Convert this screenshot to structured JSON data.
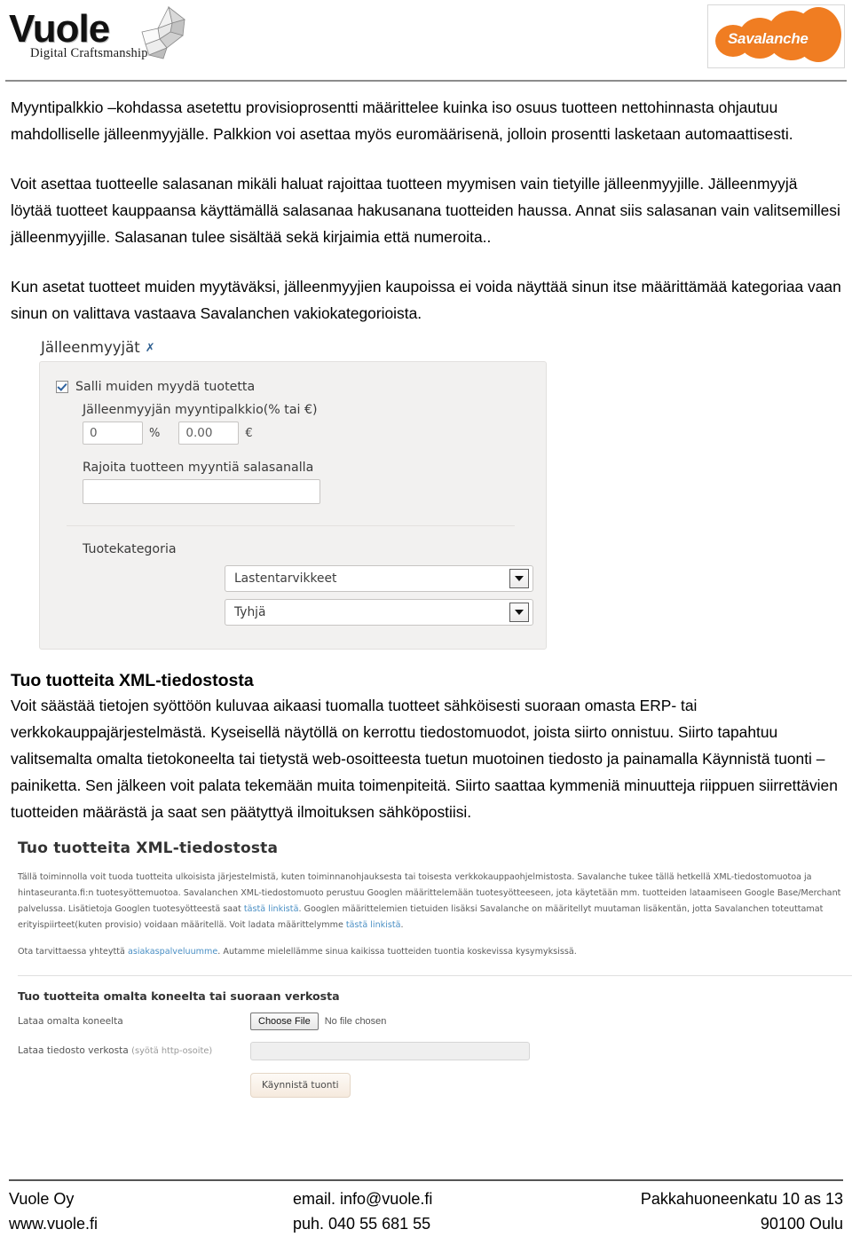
{
  "header": {
    "left_logo": {
      "word": "Vuole",
      "tagline": "Digital Craftsmanship",
      "bird_icon": "origami-bird-icon"
    },
    "right_logo": {
      "word": "Savalanche",
      "brand_color": "#f07d22"
    }
  },
  "body": {
    "para1": "Myyntipalkkio –kohdassa asetettu provisioprosentti määrittelee kuinka iso osuus tuotteen nettohinnasta ohjautuu mahdolliselle jälleenmyyjälle. Palkkion voi asettaa myös euromäärisenä, jolloin prosentti lasketaan automaattisesti.",
    "para2": "Voit asettaa tuotteelle salasanan mikäli haluat rajoittaa tuotteen myymisen vain tietyille jälleenmyyjille. Jälleenmyyjä löytää tuotteet kauppaansa käyttämällä salasanaa hakusanana tuotteiden haussa. Annat siis salasanan vain valitsemillesi jälleenmyyjille. Salasanan tulee sisältää sekä kirjaimia että numeroita..",
    "para3": "Kun asetat tuotteet muiden myytäväksi, jälleenmyyjien kaupoissa ei voida näyttää sinun itse määrittämää kategoriaa vaan sinun on valittava vastaava Savalanchen vakiokategorioista."
  },
  "reseller_panel": {
    "section_title": "Jälleenmyyjät",
    "chevron": "❯",
    "checkbox_label": "Salli muiden myydä tuotetta",
    "checkbox_checked": true,
    "commission_label": "Jälleenmyyjän myyntipalkkio(% tai €)",
    "percent_value": "0",
    "percent_unit": "%",
    "euro_value": "0.00",
    "euro_unit": "€",
    "password_label": "Rajoita tuotteen myyntiä salasanalla",
    "password_value": "",
    "category_label": "Tuotekategoria",
    "category_select_1": "Lastentarvikkeet",
    "category_select_2": "Tyhjä"
  },
  "section_xml": {
    "heading": "Tuo tuotteita XML-tiedostosta",
    "paragraph": "Voit säästää tietojen syöttöön kuluvaa aikaasi tuomalla tuotteet sähköisesti suoraan omasta ERP- tai verkkokauppajärjestelmästä. Kyseisellä näytöllä on kerrottu tiedostomuodot, joista siirto onnistuu. Siirto tapahtuu valitsemalta omalta tietokoneelta tai tietystä web-osoitteesta tuetun muotoinen tiedosto ja painamalla Käynnistä tuonti –painiketta. Sen jälkeen voit palata tekemään muita toimenpiteitä. Siirto saattaa kymmeniä minuutteja riippuen siirrettävien tuotteiden määrästä ja saat sen päätyttyä ilmoituksen sähköpostiisi."
  },
  "import_screen": {
    "title": "Tuo tuotteita XML-tiedostosta",
    "info_part1": "Tällä toiminnolla voit tuoda tuotteita ulkoisista järjestelmistä, kuten toiminnanohjauksesta tai toisesta verkkokauppaohjelmistosta. Savalanche tukee tällä hetkellä XML-tiedostomuotoa ja hintaseuranta.fi:n tuotesyöttemuotoa. Savalanchen XML-tiedostomuoto perustuu Googlen määrittelemään tuotesyötteeseen, jota käytetään mm. tuotteiden lataamiseen Google Base/Merchant palvelussa. Lisätietoja Googlen tuotesyötteestä saat ",
    "link1": "tästä linkistä",
    "info_part2": ". Googlen määrittelemien tietuiden lisäksi Savalanche on määritellyt muutaman lisäkentän, jotta Savalanchen toteuttamat erityispiirteet(kuten provisio) voidaan määritellä. Voit ladata määrittelymme ",
    "link2": "tästä linkistä",
    "info_part3": ".",
    "support_part1": "Ota tarvittaessa yhteyttä ",
    "support_link": "asiakaspalveluumme",
    "support_part2": ". Autamme mielellämme sinua kaikissa tuotteiden tuontia koskevissa kysymyksissä.",
    "subtitle": "Tuo tuotteita omalta koneelta tai suoraan verkosta",
    "file_label": "Lataa omalta koneelta",
    "choose_file_button": "Choose File",
    "no_file_text": "No file chosen",
    "url_label": "Lataa tiedosto verkosta",
    "url_hint": "(syötä http-osoite)",
    "url_value": "",
    "submit_button": "Käynnistä tuonti",
    "link_color": "#4a8fc4"
  },
  "footer": {
    "col1_line1": "Vuole Oy",
    "col1_line2": "www.vuole.fi",
    "col2_line1": "email. info@vuole.fi",
    "col2_line2": "puh. 040 55 681 55",
    "col3_line1": "Pakkahuoneenkatu 10 as 13",
    "col3_line2": "90100 Oulu"
  }
}
